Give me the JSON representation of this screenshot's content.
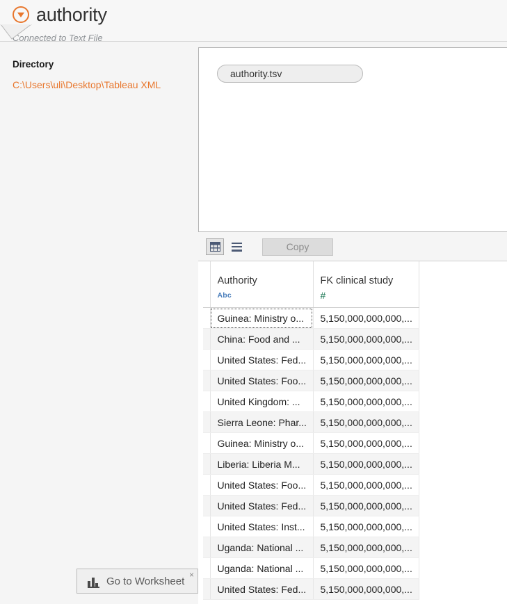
{
  "header": {
    "connection_name": "authority",
    "connection_subtitle": "Connected to Text File",
    "dropdown_icon": "circle-chevron-down-icon"
  },
  "left_pane": {
    "directory_label": "Directory",
    "directory_path": "C:\\Users\\uli\\Desktop\\Tableau XML"
  },
  "canvas": {
    "file_pill_label": "authority.tsv"
  },
  "toolbar": {
    "grid_view_icon": "grid-view-icon",
    "list_view_icon": "list-view-icon",
    "copy_label": "Copy"
  },
  "grid": {
    "columns": [
      {
        "name": "Authority",
        "type_label": "Abc",
        "type": "string"
      },
      {
        "name": "FK clinical study",
        "type_label": "#",
        "type": "number"
      }
    ],
    "rows": [
      {
        "authority": "Guinea: Ministry o...",
        "fk": "5,150,000,000,000,..."
      },
      {
        "authority": "China: Food and ...",
        "fk": "5,150,000,000,000,..."
      },
      {
        "authority": "United States: Fed...",
        "fk": "5,150,000,000,000,..."
      },
      {
        "authority": "United States: Foo...",
        "fk": "5,150,000,000,000,..."
      },
      {
        "authority": "United Kingdom: ...",
        "fk": "5,150,000,000,000,..."
      },
      {
        "authority": "Sierra Leone: Phar...",
        "fk": "5,150,000,000,000,..."
      },
      {
        "authority": "Guinea: Ministry o...",
        "fk": "5,150,000,000,000,..."
      },
      {
        "authority": "Liberia: Liberia M...",
        "fk": "5,150,000,000,000,..."
      },
      {
        "authority": "United States: Foo...",
        "fk": "5,150,000,000,000,..."
      },
      {
        "authority": "United States: Fed...",
        "fk": "5,150,000,000,000,..."
      },
      {
        "authority": "United States: Inst...",
        "fk": "5,150,000,000,000,..."
      },
      {
        "authority": "Uganda: National ...",
        "fk": "5,150,000,000,000,..."
      },
      {
        "authority": "Uganda: National ...",
        "fk": "5,150,000,000,000,..."
      },
      {
        "authority": "United States: Fed...",
        "fk": "5,150,000,000,000,..."
      }
    ]
  },
  "callout": {
    "label": "Go to Worksheet",
    "icon": "bar-chart-icon",
    "close_label": "×"
  },
  "colors": {
    "accent_orange": "#e8762c",
    "string_type_blue": "#4a7ebb",
    "number_type_green": "#1f7a57",
    "page_background": "#f5f5f5"
  }
}
